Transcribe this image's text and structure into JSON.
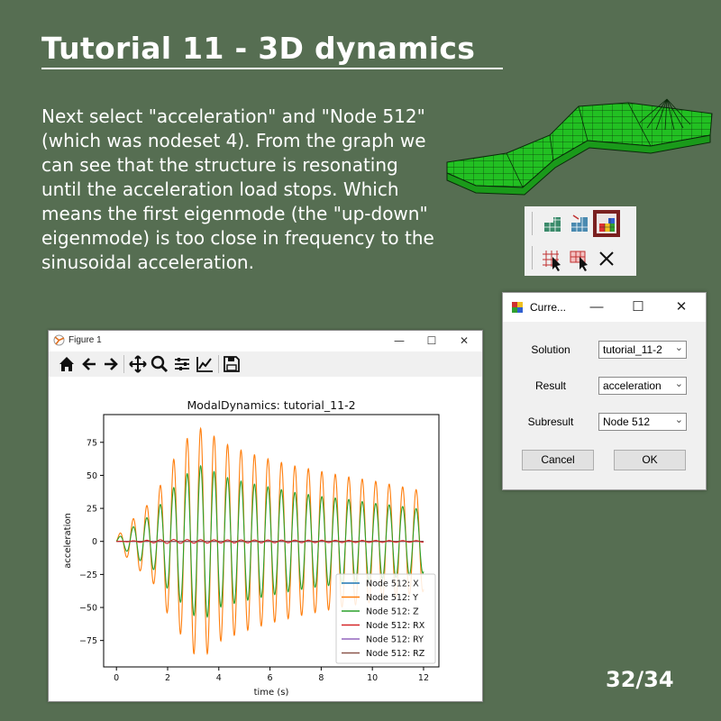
{
  "slide": {
    "title": "Tutorial 11 - 3D dynamics  ",
    "body_lines": [
      "Next select \"acceleration\" and \"Node 512\"",
      "(which was nodeset 4). From the graph we",
      "can see that the structure is resonating",
      "until the acceleration load stops. Which",
      "means the first eigenmode (the \"up-down\"",
      "eigenmode) is too close in frequency to the",
      "sinusoidal acceleration."
    ],
    "page_number": "32/34",
    "background_color": "#566e52"
  },
  "result_dialog": {
    "title": "Curre...",
    "minimize": "—",
    "maximize": "☐",
    "close": "✕",
    "solution_label": "Solution",
    "solution_value": "tutorial_11-2",
    "result_label": "Result",
    "result_value": "acceleration",
    "subresult_label": "Subresult",
    "subresult_value": "Node 512",
    "cancel_label": "Cancel",
    "ok_label": "OK"
  },
  "figure_window": {
    "title": "Figure 1",
    "minimize": "—",
    "maximize": "☐",
    "close": "✕",
    "toolbar": [
      "home-icon",
      "back-arrow-icon",
      "forward-arrow-icon",
      "pan-icon",
      "zoom-icon",
      "subplots-icon",
      "edit-axis-icon",
      "save-icon"
    ]
  },
  "chart_data": {
    "type": "line",
    "title": "ModalDynamics: tutorial_11-2",
    "xlabel": "time (s)",
    "ylabel": "acceleration",
    "xlim": [
      -0.5,
      12.6
    ],
    "ylim": [
      -95,
      96
    ],
    "xticks": [
      0,
      2,
      4,
      6,
      8,
      10,
      12
    ],
    "yticks": [
      -75,
      -50,
      -25,
      0,
      25,
      50,
      75
    ],
    "legend_position": "lower-right",
    "grid": false,
    "series": [
      {
        "name": "Node 512: X",
        "color": "#1f77b4",
        "envelope_t": [
          0,
          12
        ],
        "envelope_amp": [
          0,
          0
        ]
      },
      {
        "name": "Node 512: Y",
        "color": "#ff7f0e",
        "oscillation_hz": 1.9,
        "envelope_t": [
          0,
          0.3,
          0.8,
          1.5,
          2.0,
          2.5,
          3.0,
          3.5,
          4.0,
          5.0,
          6.0,
          7.0,
          8.0,
          9.0,
          10.0,
          11.0,
          12.0
        ],
        "envelope_amp": [
          3,
          10,
          20,
          33,
          55,
          70,
          85,
          86,
          76,
          68,
          62,
          57,
          53,
          49,
          46,
          42,
          38
        ]
      },
      {
        "name": "Node 512: Z",
        "color": "#2ca02c",
        "oscillation_hz": 1.9,
        "envelope_t": [
          0,
          0.3,
          0.8,
          1.5,
          2.0,
          2.5,
          3.0,
          3.5,
          4.0,
          5.0,
          6.0,
          7.0,
          8.0,
          9.0,
          10.0,
          11.0,
          12.0
        ],
        "envelope_amp": [
          2,
          6,
          13,
          22,
          36,
          46,
          56,
          58,
          50,
          45,
          41,
          37,
          34,
          32,
          29,
          27,
          24
        ]
      },
      {
        "name": "Node 512: RX",
        "color": "#d62728",
        "oscillation_hz": 1.9,
        "envelope_t": [
          0,
          2,
          4,
          12
        ],
        "envelope_amp": [
          0,
          1.5,
          1.2,
          0.6
        ]
      },
      {
        "name": "Node 512: RY",
        "color": "#9467bd",
        "envelope_t": [
          0,
          12
        ],
        "envelope_amp": [
          0,
          0
        ]
      },
      {
        "name": "Node 512: RZ",
        "color": "#8c564b",
        "envelope_t": [
          0,
          12
        ],
        "envelope_amp": [
          0,
          0
        ]
      }
    ]
  }
}
